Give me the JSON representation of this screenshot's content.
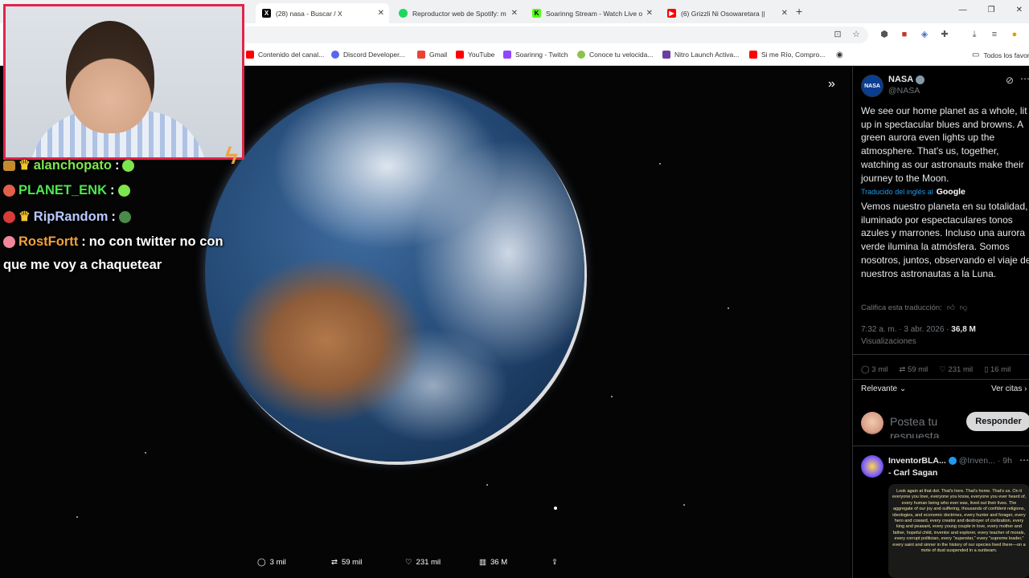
{
  "browser": {
    "tabs": [
      {
        "title": "(28) nasa - Buscar / X",
        "icon": "x-logo-icon",
        "active": true
      },
      {
        "title": "Reproductor web de Spotify: m",
        "icon": "spotify-icon"
      },
      {
        "title": "Soarinng Stream - Watch Live o",
        "icon": "kick-icon"
      },
      {
        "title": "(6) Grizzli Ni Osowaretara ||",
        "icon": "youtube-icon"
      }
    ],
    "new_tab": "+",
    "bookmarks": [
      {
        "label": "Contenido del canal...",
        "icon": "youtube-icon"
      },
      {
        "label": "Discord Developer...",
        "icon": "discord-icon"
      },
      {
        "label": "Gmail",
        "icon": "gmail-icon"
      },
      {
        "label": "YouTube",
        "icon": "youtube-icon"
      },
      {
        "label": "Soarinng - Twitch",
        "icon": "twitch-icon"
      },
      {
        "label": "Conoce tu velocida...",
        "icon": "speedtest-icon"
      },
      {
        "label": "Nitro Launch Activa...",
        "icon": "nitro-icon"
      },
      {
        "label": "Si me Río, Compro...",
        "icon": "youtube-icon"
      }
    ],
    "all_bookmarks": "Todos los favor"
  },
  "chat": [
    {
      "user": "alanchopato",
      "sep": ":",
      "message": "",
      "color": "#7ee64d"
    },
    {
      "user": "PLANET_ENK",
      "sep": ":",
      "message": "",
      "color": "#4de64d"
    },
    {
      "user": "RipRandom",
      "sep": ":",
      "message": "",
      "color": "#b9c9ff"
    },
    {
      "user": "RostFortt",
      "sep": ":",
      "message": "no con twitter no con",
      "message2": "que me voy a chaquetear",
      "color": "#f0a13a"
    }
  ],
  "media_actions": {
    "replies": "3 mil",
    "reposts": "59 mil",
    "likes": "231 mil",
    "views": "36 M"
  },
  "post": {
    "author": "NASA",
    "handle": "@NASA",
    "text_en": "We see our home planet as a whole, lit up in spectacular blues and browns. A green aurora even lights up the atmosphere. That's us, together, watching as our astronauts make their journey to the Moon.",
    "translated_by": "Traducido del inglés al",
    "translator": "Google",
    "text_es": "Vemos nuestro planeta en su totalidad, iluminado por espectaculares tonos azules y marrones. Incluso una aurora verde ilumina la atmósfera. Somos nosotros, juntos, observando el viaje de nuestros astronautas a la Luna.",
    "rate_translation": "Califica esta traducción:",
    "time": "7:32 a. m. · 3 abr. 2026 ·",
    "views": "36,8 M",
    "views_label": "Visualizaciones",
    "stats": {
      "replies": "3 mil",
      "reposts": "59 mil",
      "likes": "231 mil",
      "bookmarks": "16 mil"
    },
    "sort": "Relevante",
    "quotes": "Ver citas",
    "reply_placeholder": "Postea tu respuesta",
    "reply_button": "Responder"
  },
  "reply": {
    "author": "InventorBLA...",
    "handle": "@Inven...",
    "time": "· 9h",
    "text": "- Carl Sagan",
    "image_text": "Look again at that dot. That's here. That's home. That's us. On it everyone you love, everyone you know, everyone you ever heard of, every human being who ever was, lived out their lives. The aggregate of our joy and suffering, thousands of confident religions, ideologies, and economic doctrines, every hunter and forager, every hero and coward, every creator and destroyer of civilization, every king and peasant, every young couple in love, every mother and father, hopeful child, inventor and explorer, every teacher of morals, every corrupt politician, every \"superstar,\" every \"supreme leader,\" every saint and sinner in the history of our species lived there—on a mote of dust suspended in a sunbeam."
  },
  "colors": {
    "accent": "#1d9bf0",
    "cam_border": "#e0254a",
    "panel_bg": "#000000"
  }
}
